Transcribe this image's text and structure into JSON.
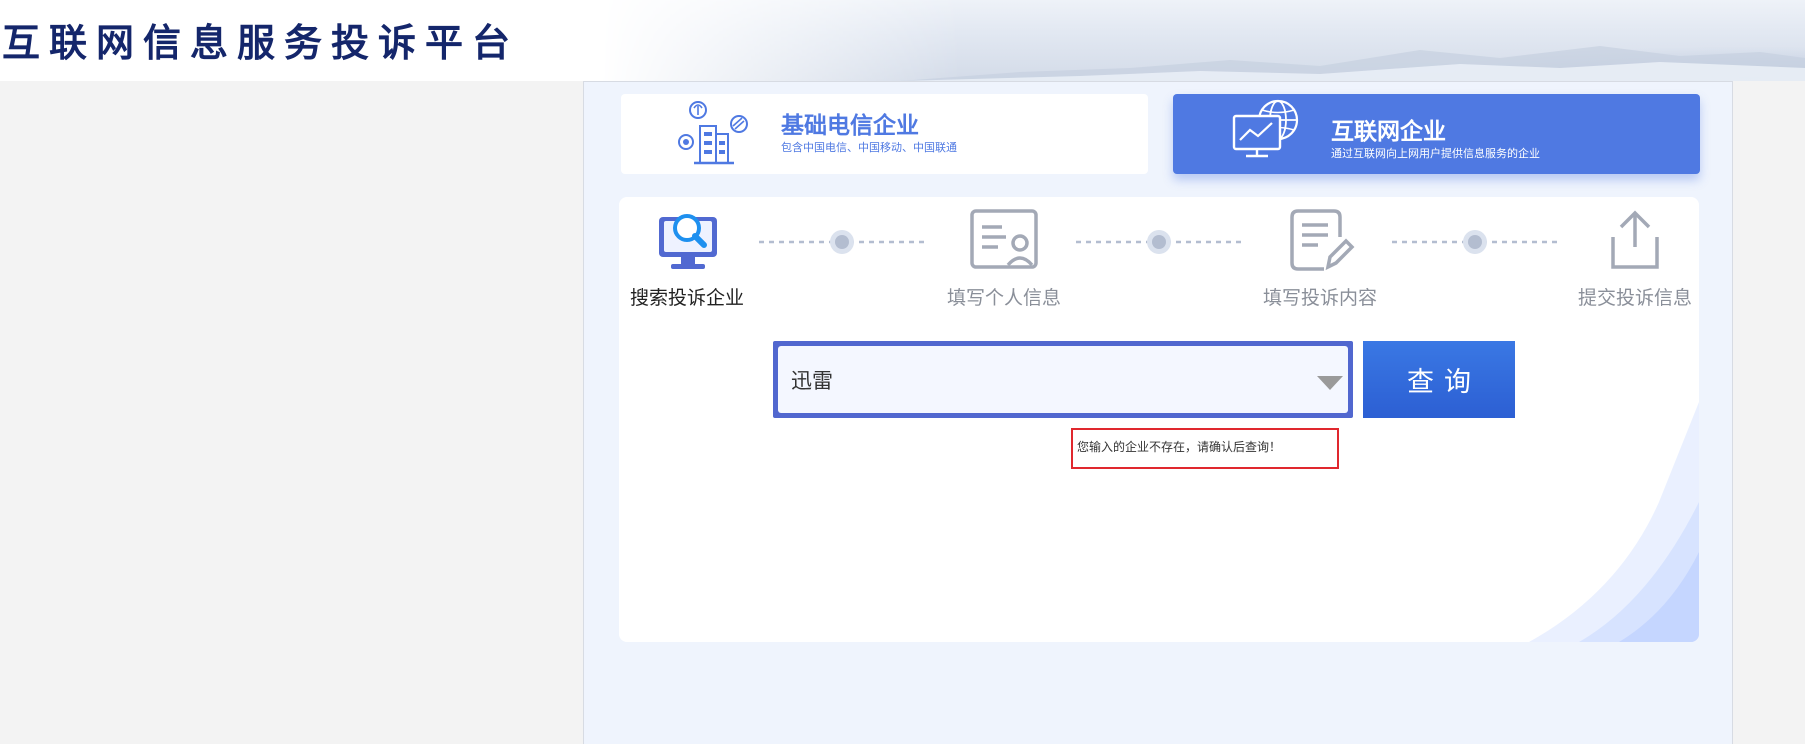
{
  "header": {
    "title": "互联网信息服务投诉平台"
  },
  "categories": [
    {
      "title": "基础电信企业",
      "subtitle": "包含中国电信、中国移动、中国联通",
      "icon": "telecom-buildings-icon",
      "selected": false
    },
    {
      "title": "互联网企业",
      "subtitle": "通过互联网向上网用户提供信息服务的企业",
      "icon": "globe-monitor-icon",
      "selected": true
    }
  ],
  "steps": [
    {
      "label": "搜索投诉企业",
      "icon": "monitor-search-icon",
      "active": true
    },
    {
      "label": "填写个人信息",
      "icon": "personal-info-icon",
      "active": false
    },
    {
      "label": "填写投诉内容",
      "icon": "edit-document-icon",
      "active": false
    },
    {
      "label": "提交投诉信息",
      "icon": "upload-icon",
      "active": false
    }
  ],
  "search": {
    "value": "迅雷",
    "button_label": "查询",
    "error": "您输入的企业不存在，请确认后查询！"
  },
  "colors": {
    "title": "#14266b",
    "accent": "#4f79e2",
    "search_border": "#5167cf",
    "error_border": "#e0282e",
    "panel_bg": "#eff4fd"
  }
}
